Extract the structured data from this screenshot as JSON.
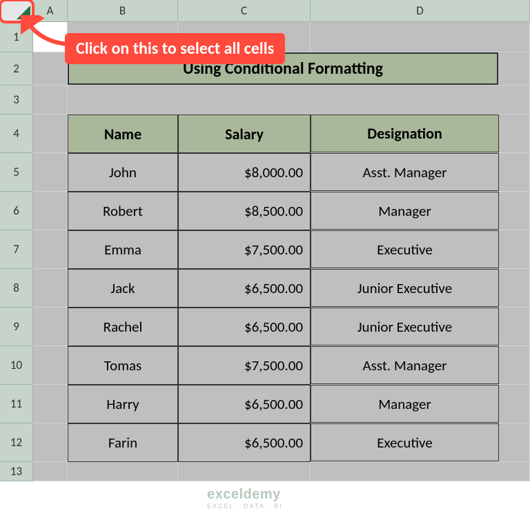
{
  "columns": [
    "A",
    "B",
    "C",
    "D"
  ],
  "rows": [
    "1",
    "2",
    "3",
    "4",
    "5",
    "6",
    "7",
    "8",
    "9",
    "10",
    "11",
    "12",
    "13"
  ],
  "title": "Using Conditional Formatting",
  "headers": {
    "name": "Name",
    "salary": "Salary",
    "designation": "Designation"
  },
  "data": [
    {
      "name": "John",
      "salary": "$8,000.00",
      "designation": "Asst. Manager"
    },
    {
      "name": "Robert",
      "salary": "$8,500.00",
      "designation": "Manager"
    },
    {
      "name": "Emma",
      "salary": "$7,500.00",
      "designation": "Executive"
    },
    {
      "name": "Jack",
      "salary": "$6,500.00",
      "designation": "Junior Executive"
    },
    {
      "name": "Rachel",
      "salary": "$6,500.00",
      "designation": "Junior Executive"
    },
    {
      "name": "Tomas",
      "salary": "$7,500.00",
      "designation": "Asst. Manager"
    },
    {
      "name": "Harry",
      "salary": "$6,500.00",
      "designation": "Manager"
    },
    {
      "name": "Farin",
      "salary": "$6,500.00",
      "designation": "Executive"
    }
  ],
  "callout": "Click on this to select all cells",
  "watermark": {
    "brand": "exceldemy",
    "tagline": "EXCEL · DATA · BI"
  }
}
